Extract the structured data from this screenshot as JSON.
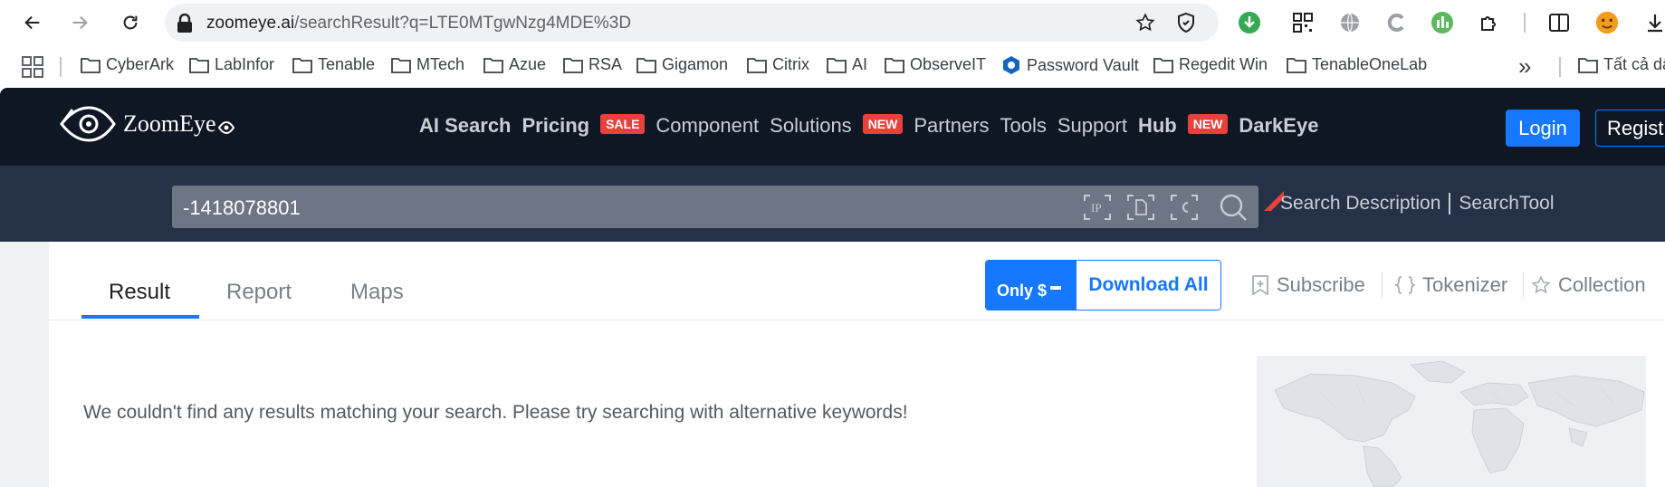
{
  "browser": {
    "url_host": "zoomeye.ai",
    "url_path": "/searchResult?q=LTE0MTgwNzg4MDE%3D",
    "bookmarks": [
      {
        "label": "CyberArk",
        "icon": "folder-icon"
      },
      {
        "label": "LabInfor",
        "icon": "folder-icon"
      },
      {
        "label": "Tenable",
        "icon": "folder-icon"
      },
      {
        "label": "MTech",
        "icon": "folder-icon"
      },
      {
        "label": "Azue",
        "icon": "folder-icon"
      },
      {
        "label": "RSA",
        "icon": "folder-icon"
      },
      {
        "label": "Gigamon",
        "icon": "folder-icon"
      },
      {
        "label": "Citrix",
        "icon": "folder-icon"
      },
      {
        "label": "AI",
        "icon": "folder-icon"
      },
      {
        "label": "ObserveIT",
        "icon": "folder-icon"
      },
      {
        "label": "Password Vault",
        "icon": "password-vault-icon"
      },
      {
        "label": "Regedit Win",
        "icon": "folder-icon"
      },
      {
        "label": "TenableOneLab",
        "icon": "folder-icon"
      }
    ],
    "overflow_label": "»",
    "other_bookmarks": "Tất cả dấ"
  },
  "site": {
    "logo_text": "ZoomEye",
    "menu": [
      {
        "label": "AI Search",
        "bold": true
      },
      {
        "label": "Pricing",
        "bold": true,
        "badge": "SALE"
      },
      {
        "label": "Component",
        "bold": false
      },
      {
        "label": "Solutions",
        "bold": false,
        "badge": "NEW"
      },
      {
        "label": "Partners",
        "bold": false
      },
      {
        "label": "Tools",
        "bold": false
      },
      {
        "label": "Support",
        "bold": false
      },
      {
        "label": "Hub",
        "bold": true,
        "badge": "NEW"
      },
      {
        "label": "DarkEye",
        "bold": true
      }
    ],
    "login_label": "Login",
    "register_label": "Regist"
  },
  "search": {
    "query": "-1418078801",
    "description_label": "Search Description",
    "tool_label": "SearchTool"
  },
  "tabs": [
    {
      "label": "Result",
      "active": true
    },
    {
      "label": "Report",
      "active": false
    },
    {
      "label": "Maps",
      "active": false
    }
  ],
  "download": {
    "only_label": "Only $",
    "download_all_label": "Download All"
  },
  "actions": {
    "subscribe_label": "Subscribe",
    "tokenizer_label": "Tokenizer",
    "collection_label": "Collection"
  },
  "results": {
    "empty_message": "We couldn't find any results matching your search. Please try searching with alternative keywords!"
  },
  "colors": {
    "header_bg": "#0f1725",
    "search_band_bg": "#253147",
    "accent": "#1677ff",
    "badge_red": "#e8413c"
  }
}
